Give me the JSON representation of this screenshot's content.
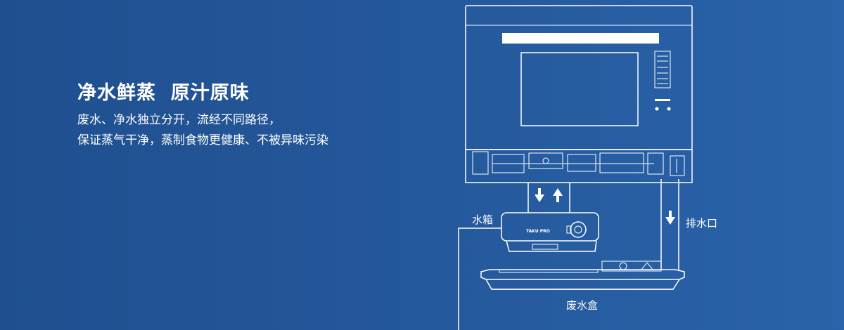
{
  "headline": "净水鲜蒸  原汁原味",
  "description": {
    "line1": "废水、净水独立分开，流经不同路径，",
    "line2": "保证蒸气干净，蒸制食物更健康、不被异味污染"
  },
  "labels": {
    "water_tank": "水箱",
    "drain_outlet": "排水口",
    "waste_box": "废水盒"
  },
  "tank_brand": "TAKU PRO",
  "colors": {
    "background": "#24579a",
    "line": "#ffffff"
  }
}
